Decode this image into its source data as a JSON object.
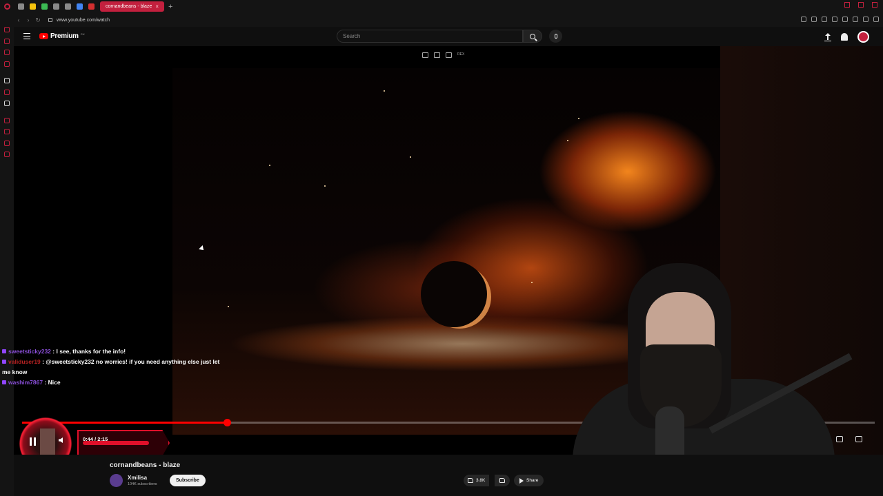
{
  "browser": {
    "active_tab_title": "cornandbeans - blaze",
    "url": "www.youtube.com/watch"
  },
  "masthead": {
    "logo_text": "Premium",
    "logo_sup": "CU",
    "search_placeholder": "Search"
  },
  "player": {
    "time_display": "0:44 / 2:15",
    "progress_fraction": 0.24,
    "overlay_badge": "REX"
  },
  "chat": {
    "messages": [
      {
        "user": "sweetsticky232",
        "text": ": I see, thanks for the info!"
      },
      {
        "user": "validuser19",
        "text": ": @sweetsticky232 no worries! if you need anything else just let me know"
      },
      {
        "user": "washim7867",
        "text": ": Nice"
      }
    ]
  },
  "video": {
    "title": "cornandbeans - blaze",
    "channel": "Xmilisa",
    "subscribers": "104K subscribers",
    "subscribe_label": "Subscribe",
    "likes": "3.8K",
    "share_label": "Share"
  },
  "colors": {
    "accent": "#c3203e",
    "yt_red": "#ff0000",
    "chat_user": "#8a4fd9"
  }
}
